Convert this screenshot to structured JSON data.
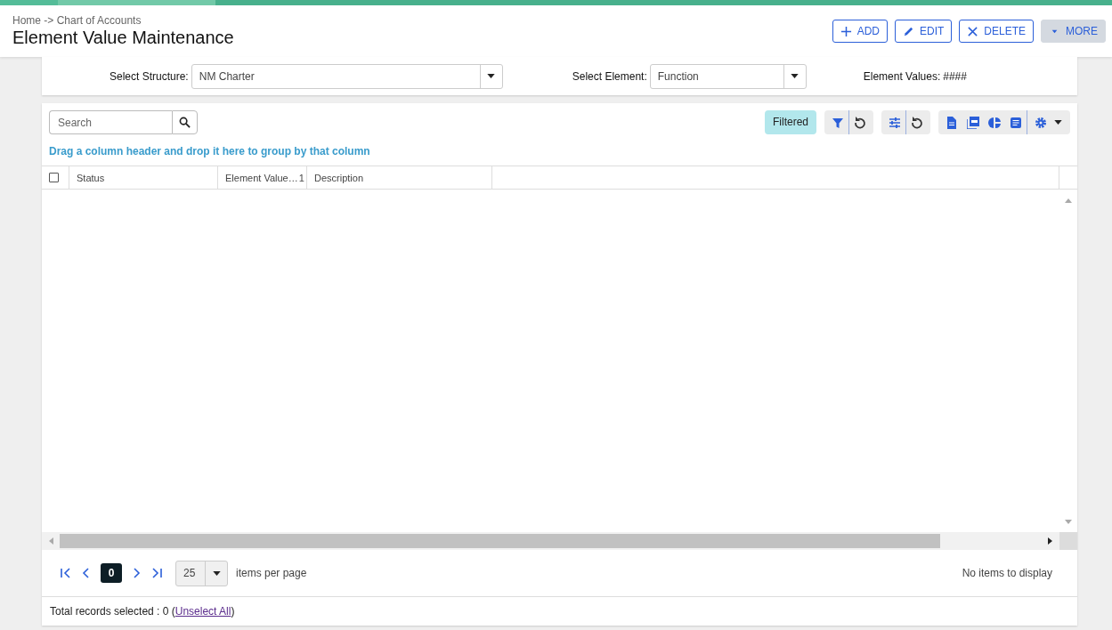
{
  "breadcrumb": "Home -> Chart of Accounts",
  "title": "Element Value Maintenance",
  "actions": [
    {
      "label": "ADD",
      "kind": "add"
    },
    {
      "label": "EDIT",
      "kind": "edit"
    },
    {
      "label": "DELETE",
      "kind": "delete"
    },
    {
      "label": "MORE",
      "kind": "more"
    }
  ],
  "filters": [
    {
      "label": "Select Structure:",
      "value": "NM Charter",
      "kind": "dropdown"
    },
    {
      "label": "Select Element:",
      "value": "Function",
      "kind": "dropdown"
    },
    {
      "label": "Element Values:",
      "value": "####",
      "kind": "readout"
    }
  ],
  "grid": {
    "search": {
      "placeholder": "Search"
    },
    "filter_badge": "Filtered",
    "group_hint": "Drag a column header and drop it here to group by that column",
    "select_all": {
      "checked": false
    },
    "columns": [
      {
        "label": "Status"
      },
      {
        "label": "Element Value…",
        "sort_index": "1"
      },
      {
        "label": "Description"
      }
    ],
    "pager": {
      "page": "0",
      "page_size": "25",
      "page_size_label": "items per page",
      "info": "No items to display"
    },
    "footer": {
      "text": "Total records selected : 0 (",
      "link": "Unselect All",
      "after": ")"
    }
  }
}
